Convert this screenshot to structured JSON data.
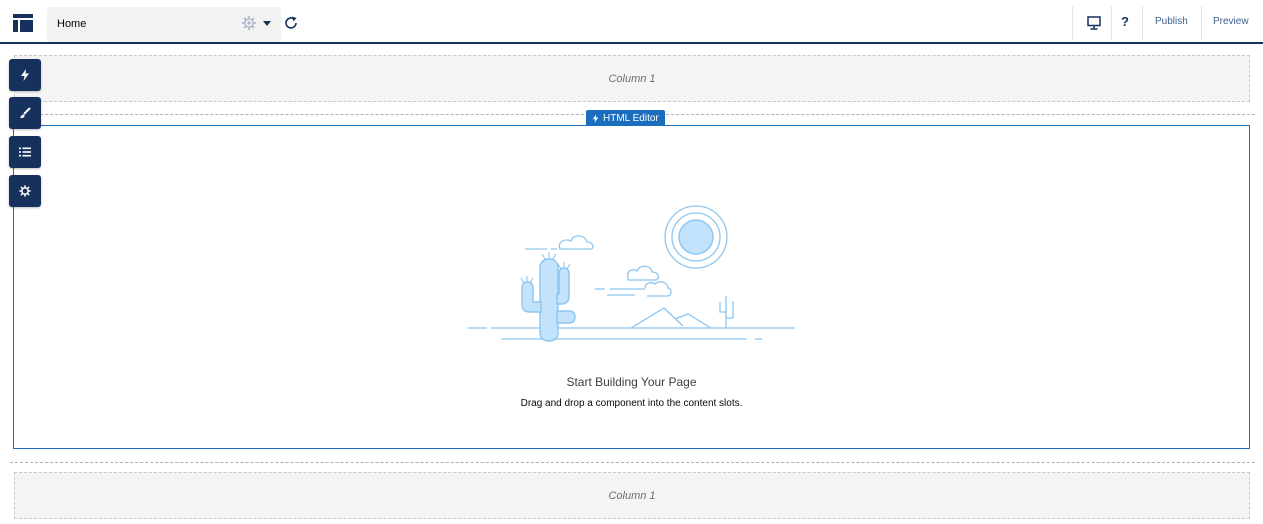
{
  "topbar": {
    "page_name": "Home",
    "help_label": "?",
    "publish_label": "Publish",
    "preview_label": "Preview"
  },
  "tools": [
    {
      "name": "components",
      "icon": "lightning-icon"
    },
    {
      "name": "theme",
      "icon": "brush-icon"
    },
    {
      "name": "page-structure",
      "icon": "list-icon"
    },
    {
      "name": "settings",
      "icon": "gear-icon"
    }
  ],
  "regions": {
    "top_column_label": "Column 1",
    "bottom_column_label": "Column 1",
    "editor_badge_label": "HTML Editor"
  },
  "empty_state": {
    "title": "Start Building Your Page",
    "subtitle": "Drag and drop a component into the content slots."
  },
  "colors": {
    "accent": "#1b6dbd",
    "toolbar_dark": "#16325c",
    "illustration_blue": "#8dc6f0"
  }
}
